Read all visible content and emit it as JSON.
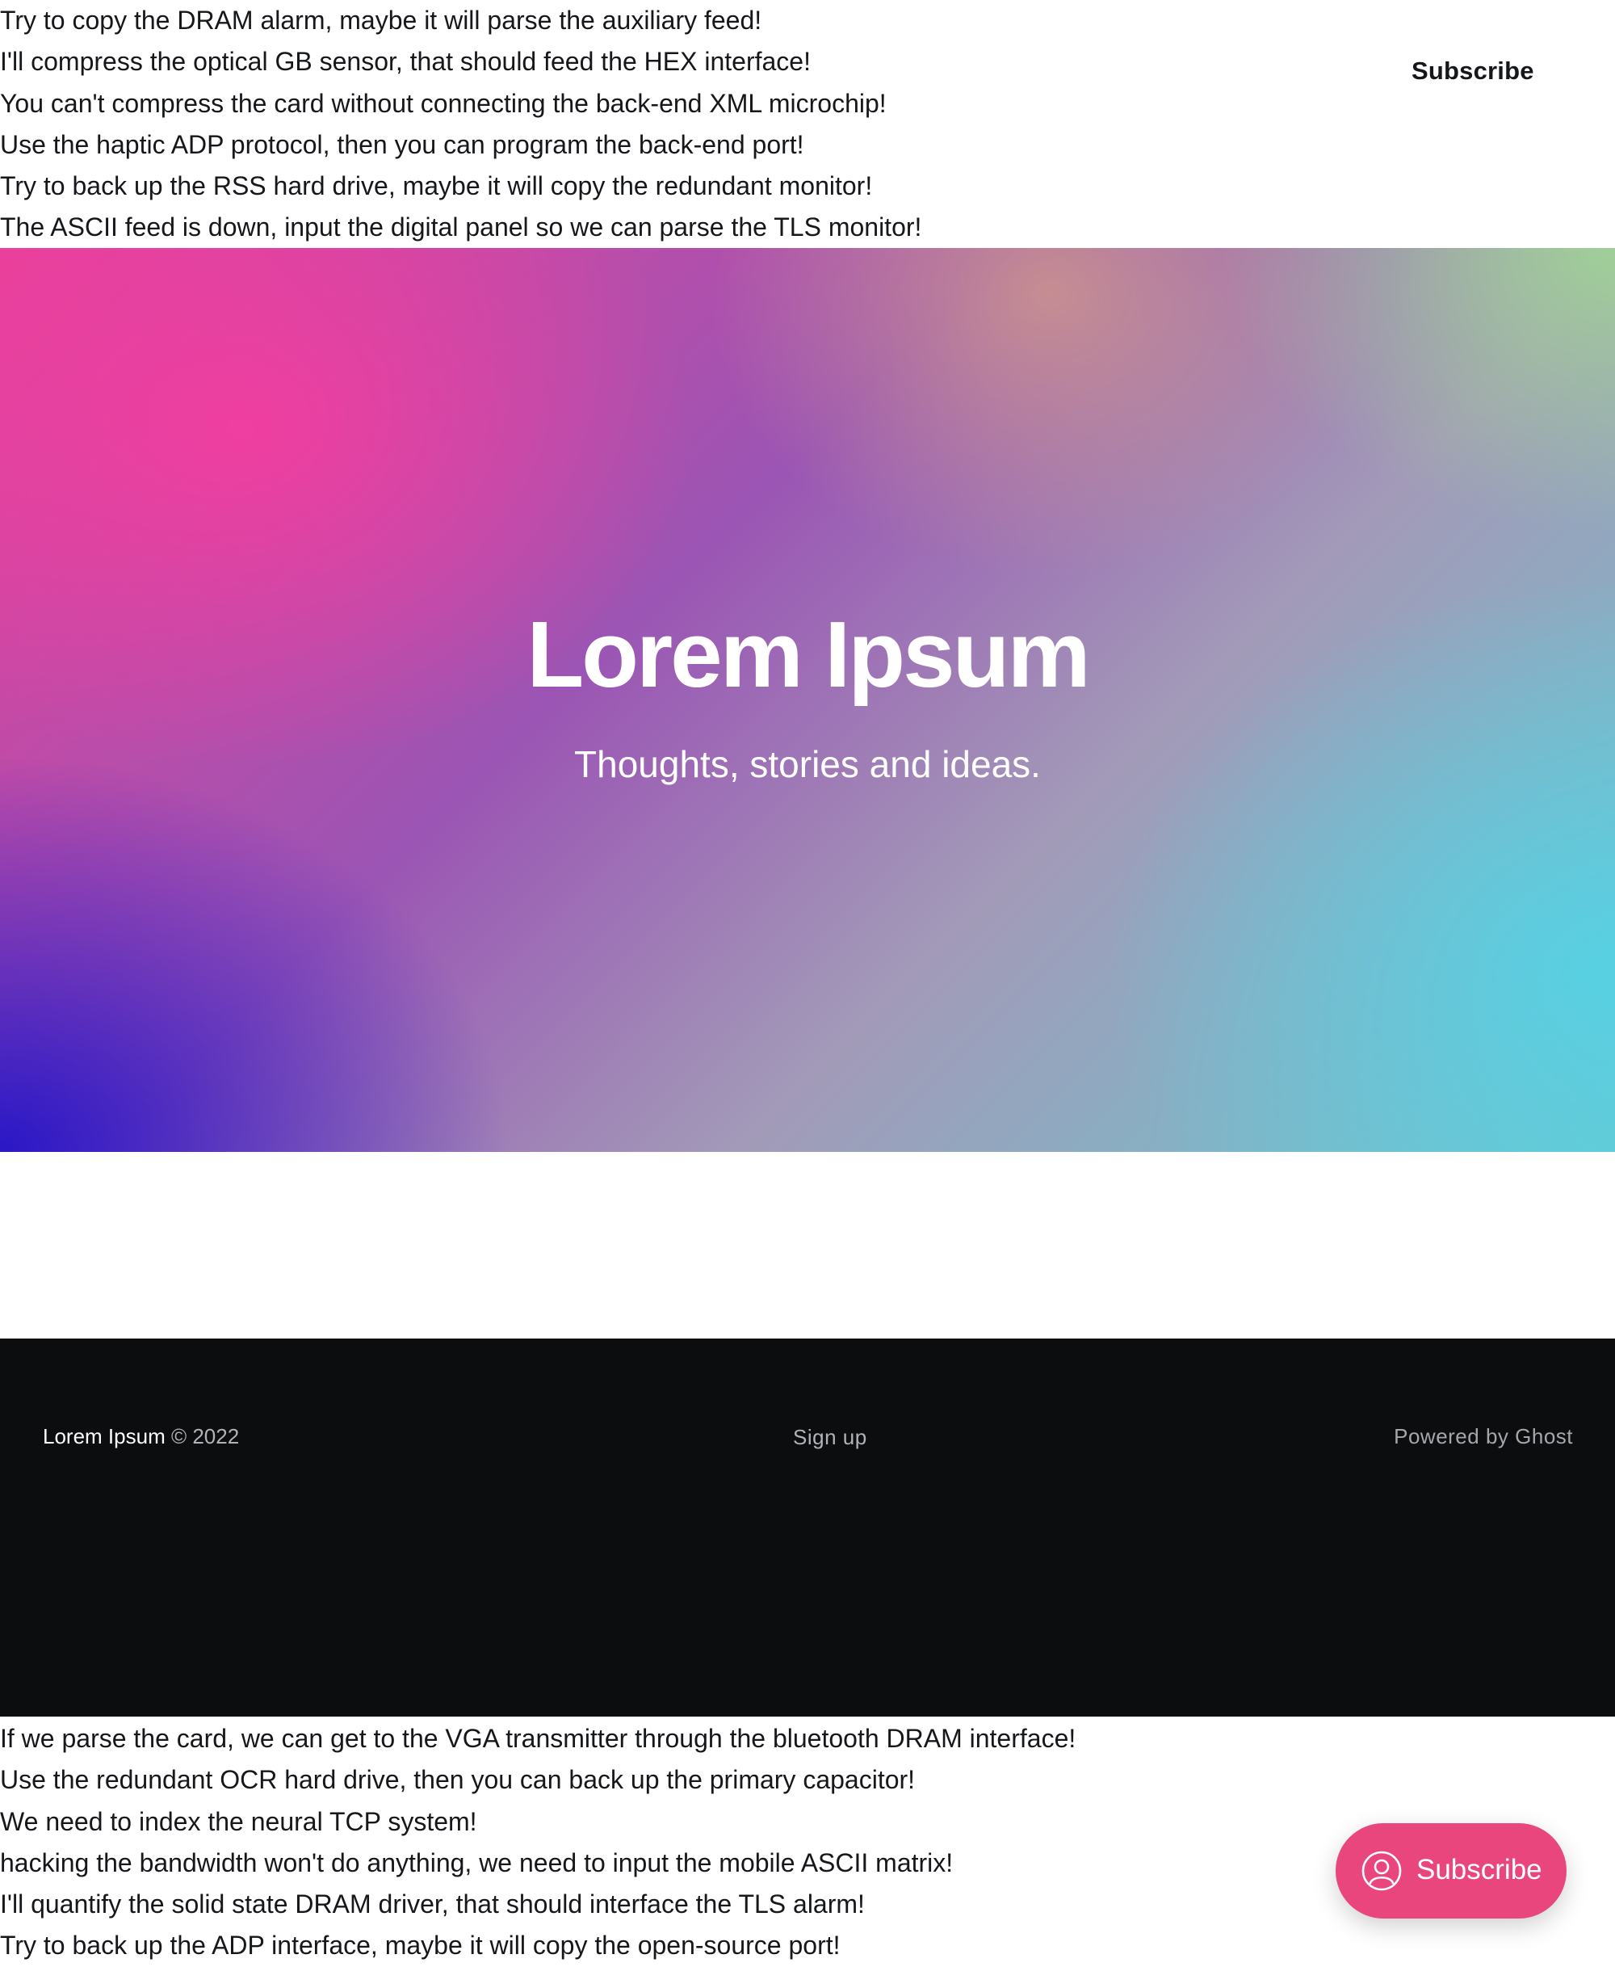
{
  "filler": {
    "top": [
      "Try to copy the DRAM alarm, maybe it will parse the auxiliary feed!",
      "I'll compress the optical GB sensor, that should feed the HEX interface!",
      "You can't compress the card without connecting the back-end XML microchip!",
      "Use the haptic ADP protocol, then you can program the back-end port!",
      "Try to back up the RSS hard drive, maybe it will copy the redundant monitor!",
      "The ASCII feed is down, input the digital panel so we can parse the TLS monitor!"
    ],
    "bottom": [
      "If we parse the card, we can get to the VGA transmitter through the bluetooth DRAM interface!",
      "Use the redundant OCR hard drive, then you can back up the primary capacitor!",
      "We need to index the neural TCP system!",
      "hacking the bandwidth won't do anything, we need to input the mobile ASCII matrix!",
      "I'll quantify the solid state DRAM driver, that should interface the TLS alarm!",
      "Try to back up the ADP interface, maybe it will copy the open-source port!"
    ]
  },
  "header": {
    "subscribe_label": "Subscribe"
  },
  "hero": {
    "title": "Lorem Ipsum",
    "subtitle": "Thoughts, stories and ideas."
  },
  "footer": {
    "site_name": "Lorem Ipsum",
    "copyright": "© 2022",
    "signup_label": "Sign up",
    "powered_by": "Powered by Ghost"
  },
  "floating_button": {
    "label": "Subscribe",
    "icon": "user-circle-icon",
    "color": "#e8467c"
  }
}
